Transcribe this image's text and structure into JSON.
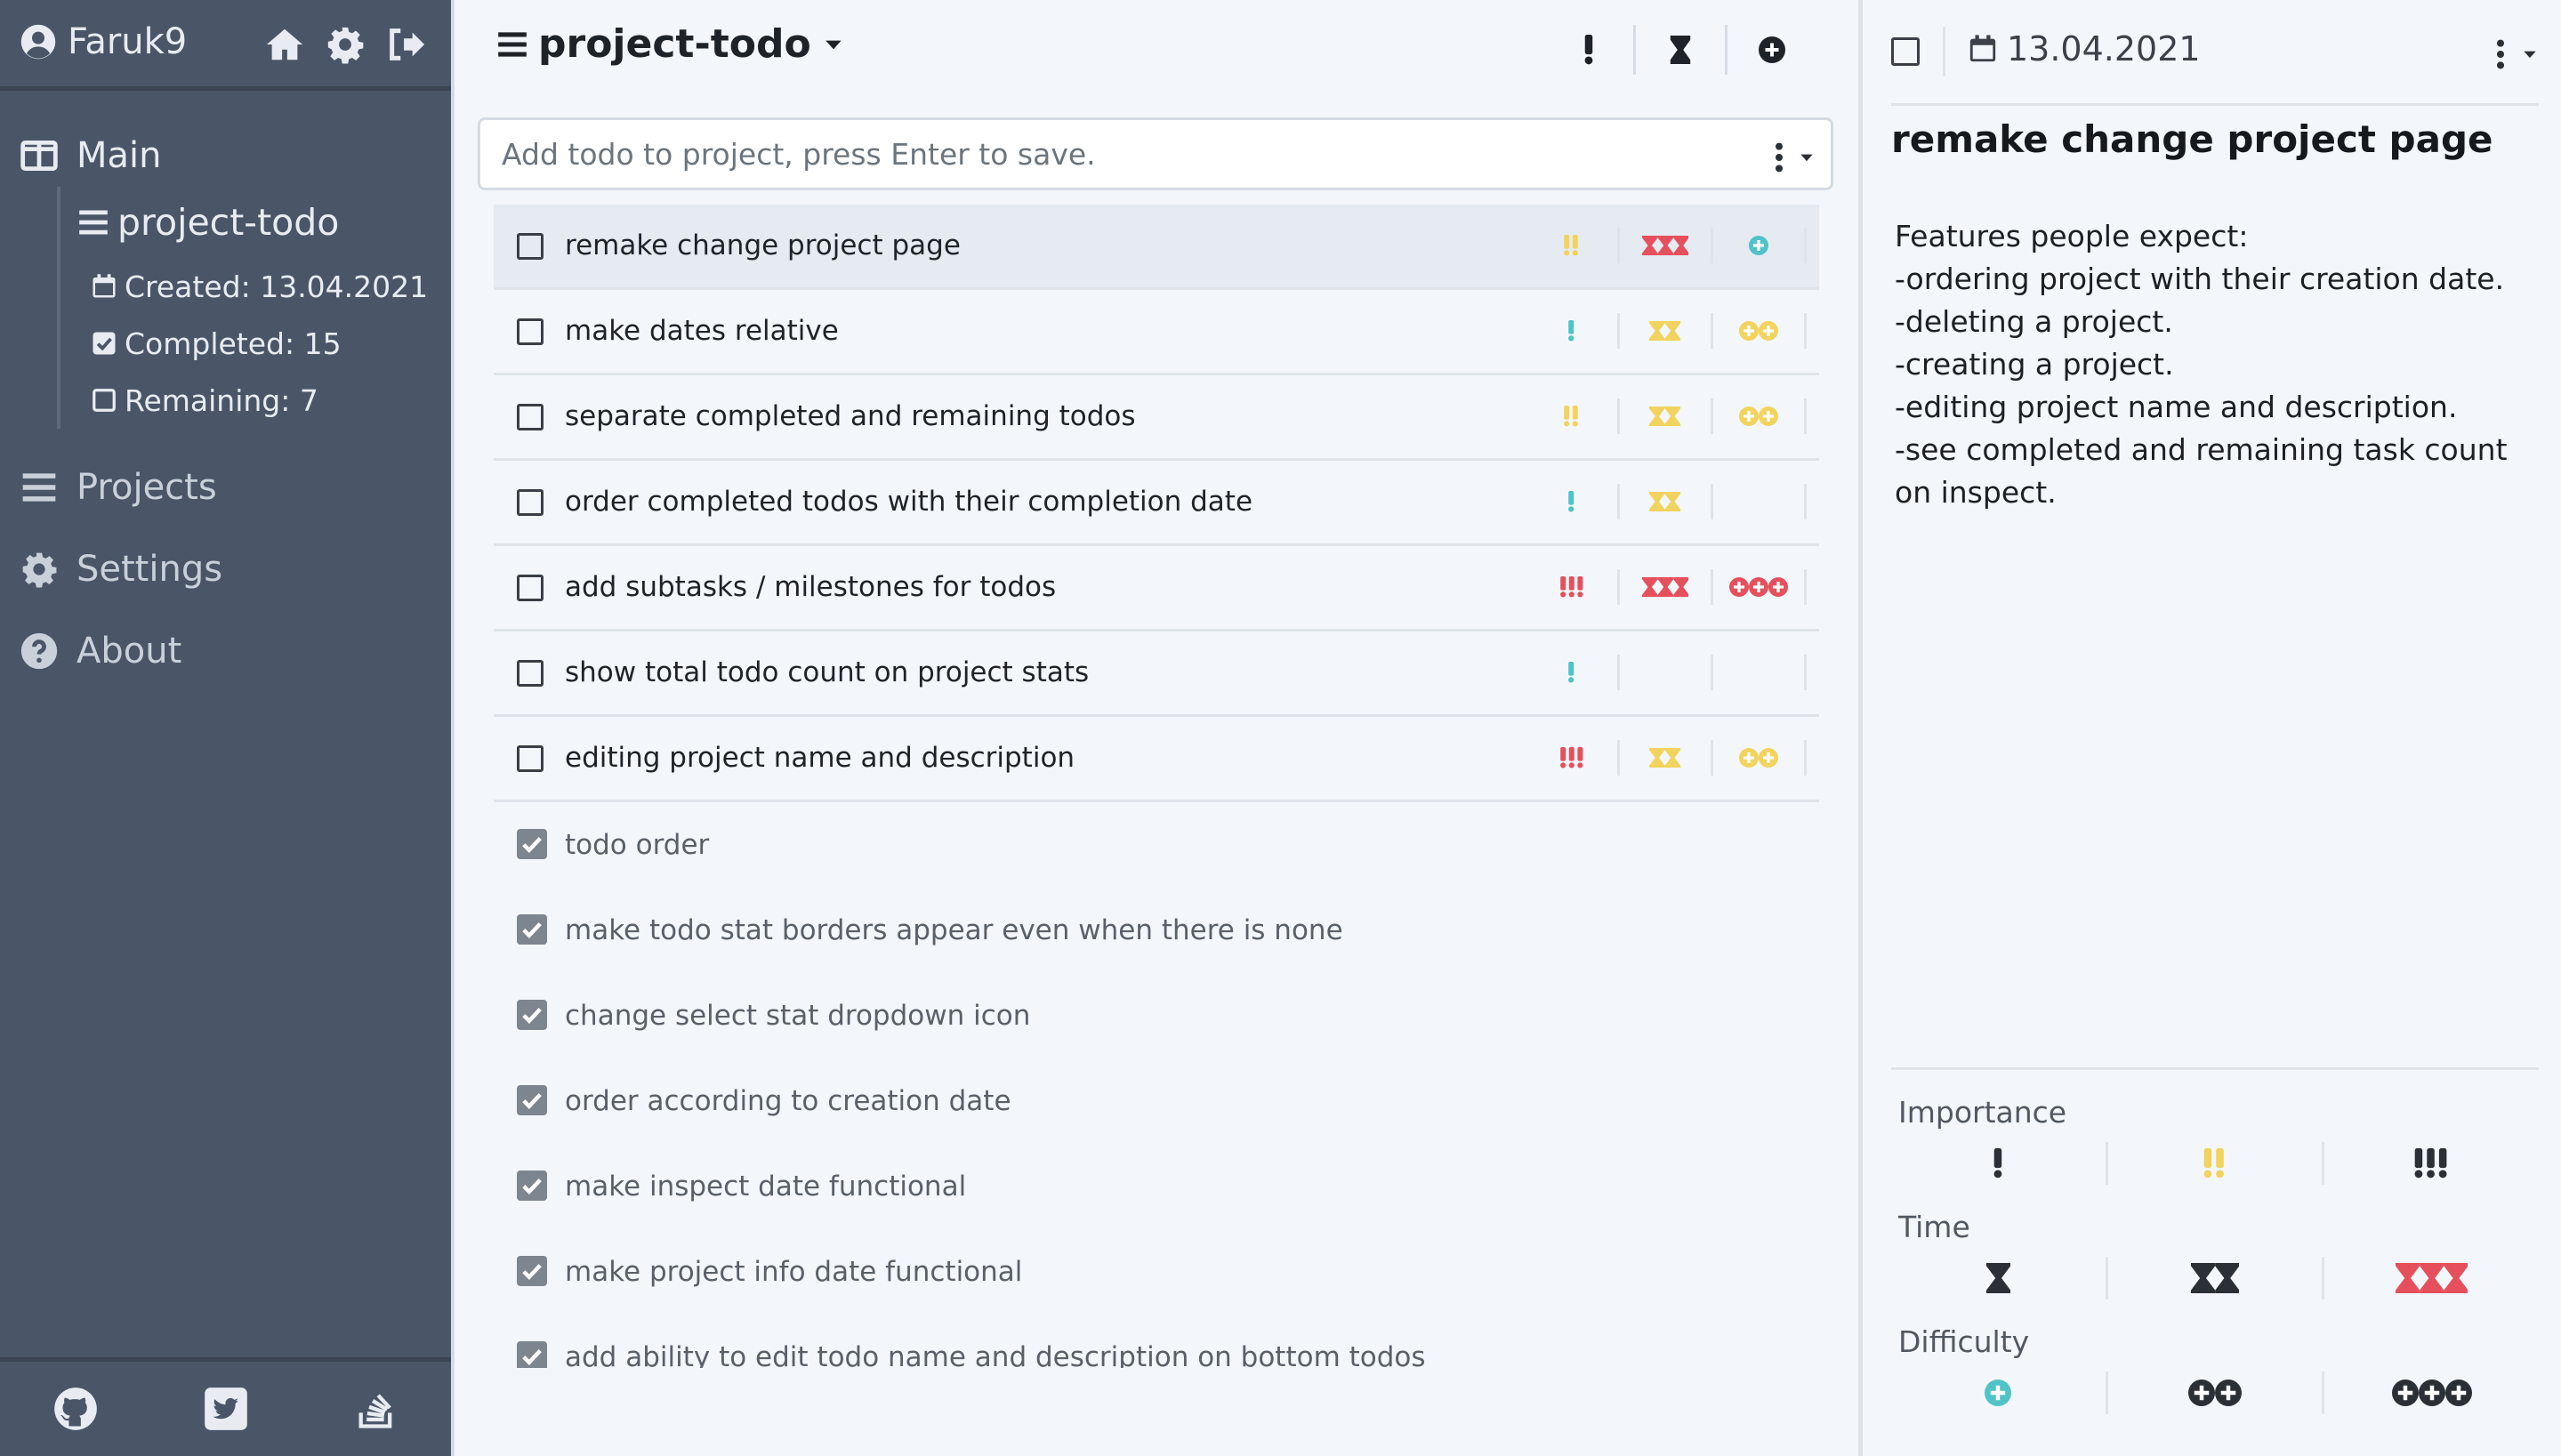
{
  "colors": {
    "sidebar": "#4a5568",
    "low": "#4fc3c8",
    "mid": "#f2d35e",
    "high": "#e5505c",
    "neutral": "#2b2f36"
  },
  "sidebar": {
    "user": "Faruk9",
    "header_icons": [
      "home-icon",
      "gear-icon",
      "sign-out-icon"
    ],
    "main_label": "Main",
    "project": {
      "name": "project-todo",
      "created": "Created: 13.04.2021",
      "completed": "Completed: 15",
      "remaining": "Remaining: 7"
    },
    "nav": [
      {
        "label": "Projects",
        "icon": "bars-icon"
      },
      {
        "label": "Settings",
        "icon": "gear-icon"
      },
      {
        "label": "About",
        "icon": "question-circle-icon"
      }
    ],
    "footer_icons": [
      "github-icon",
      "twitter-icon",
      "stackoverflow-icon"
    ]
  },
  "main": {
    "title": "project-todo",
    "add_placeholder": "Add todo to project, press Enter to save.",
    "todos": [
      {
        "text": "remake change project page",
        "importance": [
          2,
          "mid"
        ],
        "time": [
          3,
          "high"
        ],
        "difficulty": [
          1,
          "low"
        ],
        "selected": true
      },
      {
        "text": "make dates relative",
        "importance": [
          1,
          "low"
        ],
        "time": [
          2,
          "mid"
        ],
        "difficulty": [
          2,
          "mid"
        ]
      },
      {
        "text": "separate completed and remaining todos",
        "importance": [
          2,
          "mid"
        ],
        "time": [
          2,
          "mid"
        ],
        "difficulty": [
          2,
          "mid"
        ]
      },
      {
        "text": "order completed todos with their completion date",
        "importance": [
          1,
          "low"
        ],
        "time": [
          2,
          "mid"
        ],
        "difficulty": [
          0,
          ""
        ]
      },
      {
        "text": "add subtasks / milestones for todos",
        "importance": [
          3,
          "high"
        ],
        "time": [
          3,
          "high"
        ],
        "difficulty": [
          3,
          "high"
        ]
      },
      {
        "text": "show total todo count on project stats",
        "importance": [
          1,
          "low"
        ],
        "time": [
          0,
          ""
        ],
        "difficulty": [
          0,
          ""
        ]
      },
      {
        "text": "editing project name and description",
        "importance": [
          3,
          "high"
        ],
        "time": [
          2,
          "mid"
        ],
        "difficulty": [
          2,
          "mid"
        ]
      }
    ],
    "completed": [
      "todo order",
      "make todo stat borders appear even when there is none",
      "change select stat dropdown icon",
      "order according to creation date",
      "make inspect date functional",
      "make project info date functional",
      "add ability to edit todo name and description on bottom todos"
    ]
  },
  "detail": {
    "date": "13.04.2021",
    "title": "remake change project page",
    "description": "Features people expect:\n-ordering project with their creation date.\n-deleting a project.\n-creating a project.\n-editing project name and description.\n-see completed and remaining task count on inspect.",
    "importance_label": "Importance",
    "time_label": "Time",
    "difficulty_label": "Difficulty"
  }
}
